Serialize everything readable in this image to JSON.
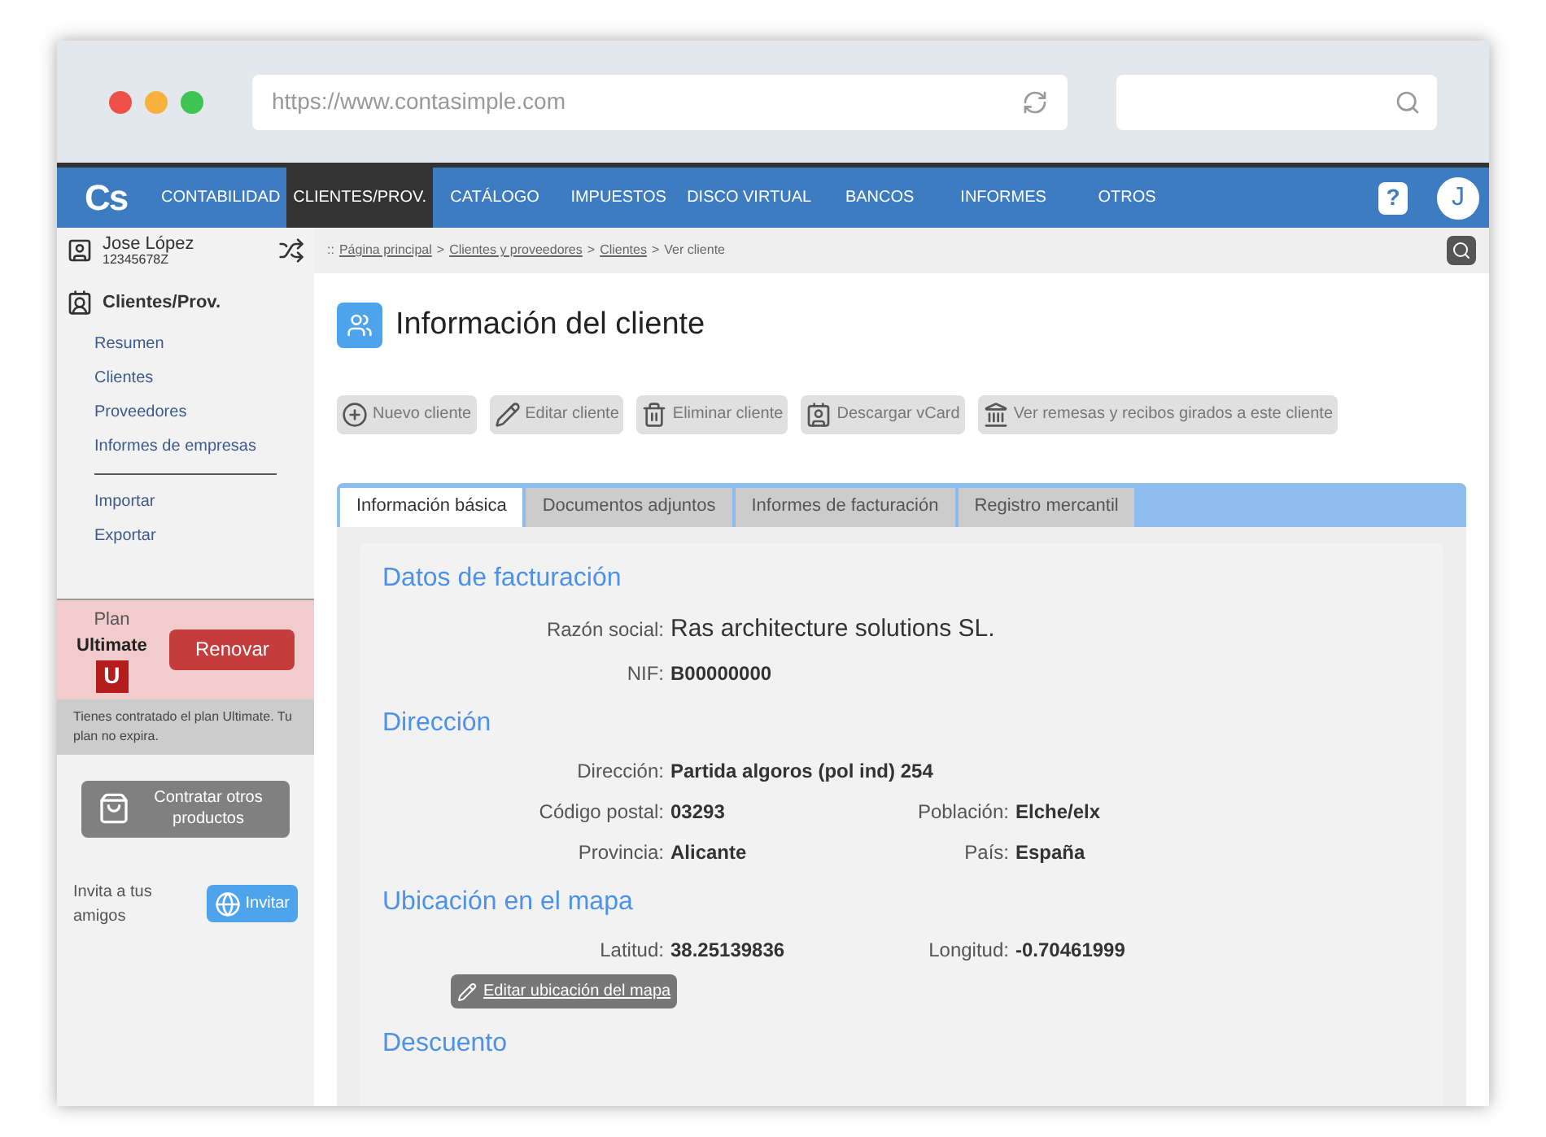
{
  "browser": {
    "url": "https://www.contasimple.com"
  },
  "nav": {
    "logo": "Cs",
    "items": [
      {
        "label": "CONTABILIDAD",
        "selected": false
      },
      {
        "label": "CLIENTES/PROV.",
        "selected": true
      },
      {
        "label": "CATÁLOGO",
        "selected": false
      },
      {
        "label": "IMPUESTOS",
        "selected": false
      },
      {
        "label": "DISCO VIRTUAL",
        "selected": false
      },
      {
        "label": "BANCOS",
        "selected": false
      },
      {
        "label": "INFORMES",
        "selected": false
      },
      {
        "label": "OTROS",
        "selected": false
      }
    ],
    "help": "?",
    "avatar": "J"
  },
  "user": {
    "name": "Jose López",
    "id": "12345678Z"
  },
  "sidebar": {
    "title": "Clientes/Prov.",
    "groups": [
      [
        "Resumen",
        "Clientes",
        "Proveedores",
        "Informes de empresas"
      ],
      [
        "Importar",
        "Exportar"
      ]
    ],
    "plan": {
      "label": "Plan",
      "name": "Ultimate",
      "badge": "U",
      "button": "Renovar",
      "note": "Tienes contratado el plan Ultimate. Tu plan no expira."
    },
    "products_button": "Contratar otros productos",
    "invite_text": "Invita a tus amigos",
    "invite_button": "Invitar"
  },
  "breadcrumb": {
    "prefix": "::",
    "links": [
      "Página principal",
      "Clientes y proveedores",
      "Clientes"
    ],
    "separator": ">",
    "current": "Ver cliente"
  },
  "page_title": "Información del cliente",
  "toolbar": [
    {
      "kind": "add",
      "label": "Nuevo cliente"
    },
    {
      "kind": "edit",
      "label": "Editar cliente"
    },
    {
      "kind": "delete",
      "label": "Eliminar cliente"
    },
    {
      "kind": "vcard",
      "label": "Descargar vCard"
    },
    {
      "kind": "bank",
      "label": "Ver remesas y recibos girados a este cliente"
    }
  ],
  "tabs": [
    {
      "label": "Información básica",
      "selected": true
    },
    {
      "label": "Documentos adjuntos",
      "selected": false
    },
    {
      "label": "Informes de facturación",
      "selected": false
    },
    {
      "label": "Registro mercantil",
      "selected": false
    }
  ],
  "sections": [
    {
      "title": "Datos de facturación",
      "rows": [
        [
          {
            "label": "Razón social:",
            "value": "Ras architecture solutions SL.",
            "kind": "large"
          }
        ],
        [
          {
            "label": "NIF:",
            "value": "B00000000",
            "kind": "plain"
          }
        ]
      ]
    },
    {
      "title": "Dirección",
      "rows": [
        [
          {
            "label": "Dirección:",
            "value": "Partida algoros (pol ind) 254",
            "kind": "plain"
          }
        ],
        [
          {
            "label": "Código postal:",
            "value": "03293",
            "kind": "plain"
          },
          {
            "label": "Población:",
            "value": "Elche/elx",
            "kind": "plain"
          }
        ],
        [
          {
            "label": "Provincia:",
            "value": "Alicante",
            "kind": "plain"
          },
          {
            "label": "País:",
            "value": "España",
            "kind": "plain"
          }
        ]
      ]
    },
    {
      "title": "Ubicación en el mapa",
      "rows": [
        [
          {
            "label": "Latitud:",
            "value": "38.25139836",
            "kind": "plain"
          },
          {
            "label": "Longitud:",
            "value": "-0.70461999",
            "kind": "plain"
          }
        ]
      ],
      "button": "Editar ubicación del mapa"
    },
    {
      "title": "Descuento"
    }
  ]
}
